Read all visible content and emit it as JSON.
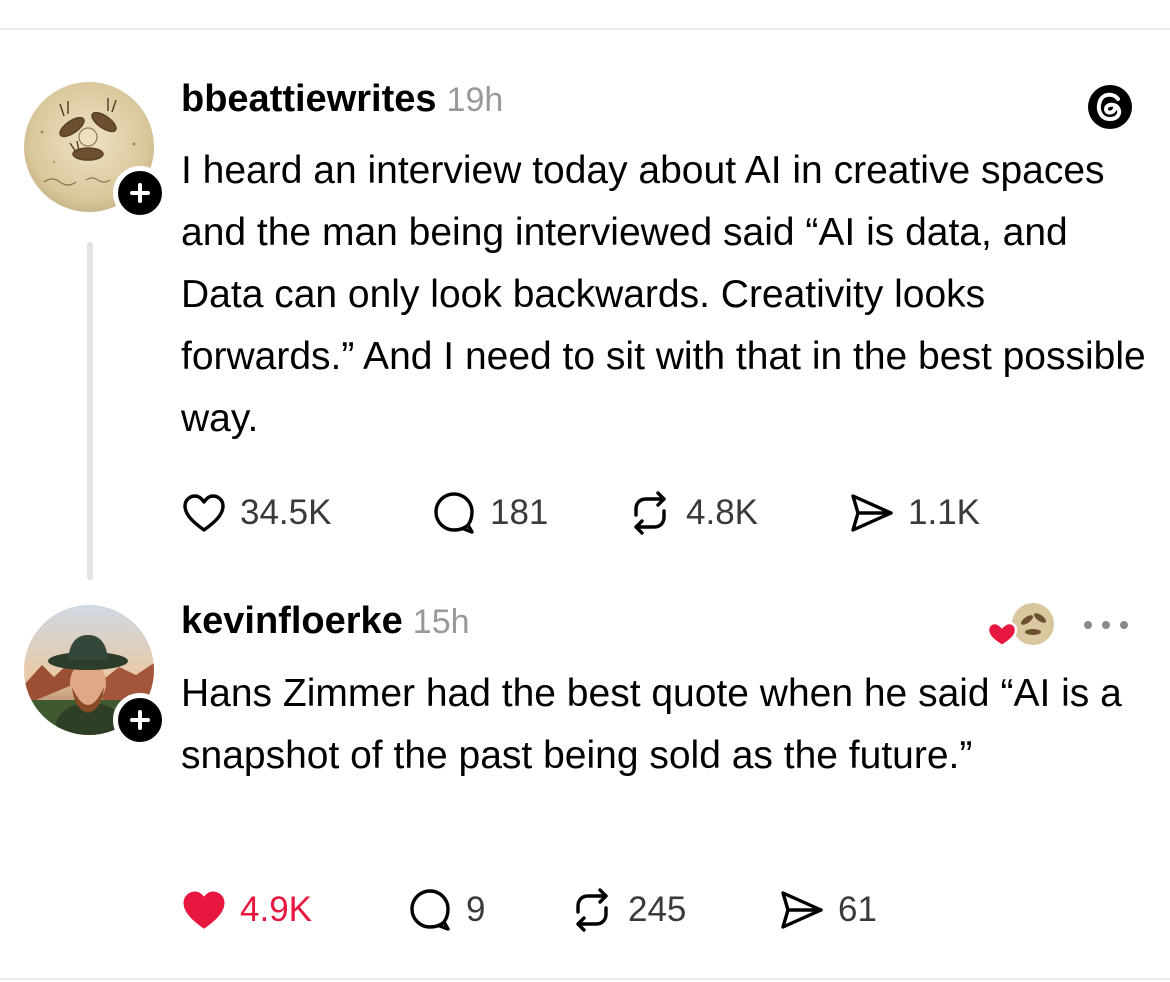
{
  "theme": {
    "like_color": "#e8173f",
    "text_color": "#000000",
    "muted_color": "#999999",
    "count_color": "#3a3a3a"
  },
  "posts": [
    {
      "username": "bbeattiewrites",
      "time": "19h",
      "avatar_icon": "sketch-avatar",
      "text": "I heard an interview today about AI in creative spaces and the man being interviewed said “AI is data, and Data can only look backwards. Creativity looks forwards.” And I need to sit with that in the best possible way.",
      "liked": false,
      "likes": "34.5K",
      "replies": "181",
      "reposts": "4.8K",
      "shares": "1.1K"
    },
    {
      "username": "kevinfloerke",
      "time": "15h",
      "avatar_icon": "photo-avatar",
      "text": "Hans Zimmer had the best quote when he said “AI is a snapshot of the past being sold as the future.”",
      "liked": true,
      "likes": "4.9K",
      "replies": "9",
      "reposts": "245",
      "shares": "61"
    }
  ]
}
